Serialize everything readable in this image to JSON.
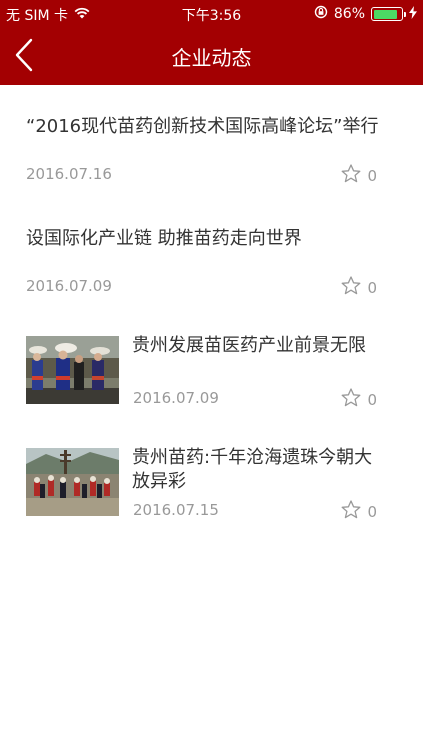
{
  "status_bar": {
    "carrier": "无 SIM 卡",
    "wifi_icon": "wifi-icon",
    "time": "下午3:56",
    "battery_percent": "86%",
    "battery_level": 0.86
  },
  "nav": {
    "back_icon": "chevron-left-icon",
    "title": "企业动态"
  },
  "news": [
    {
      "title": "“2016现代苗药创新技术国际高峰论坛”举行",
      "date": "2016.07.16",
      "likes": "0",
      "has_image": false
    },
    {
      "title": "设国际化产业链 助推苗药走向世界",
      "date": "2016.07.09",
      "likes": "0",
      "has_image": false
    },
    {
      "title": "贵州发展苗医药产业前景无限",
      "date": "2016.07.09",
      "likes": "0",
      "has_image": true
    },
    {
      "title": "贵州苗药:千年沧海遗珠今朝大放异彩",
      "date": "2016.07.15",
      "likes": "0",
      "has_image": true
    }
  ],
  "colors": {
    "header_bg": "#a30002",
    "text": "#333333",
    "meta": "#999999"
  }
}
